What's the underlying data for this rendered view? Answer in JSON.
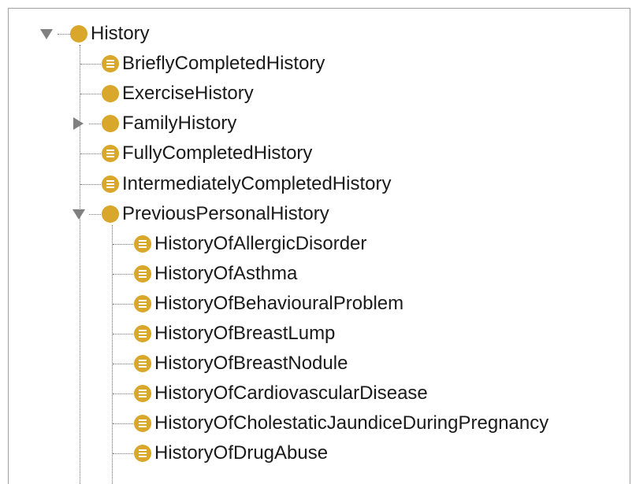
{
  "tree": {
    "root": {
      "label": "History",
      "icon": "class-icon",
      "expanded": true
    },
    "children": [
      {
        "label": "BrieflyCompletedHistory",
        "icon": "defined-class-icon"
      },
      {
        "label": "ExerciseHistory",
        "icon": "class-icon"
      },
      {
        "label": "FamilyHistory",
        "icon": "class-icon",
        "expanded": false
      },
      {
        "label": "FullyCompletedHistory",
        "icon": "defined-class-icon"
      },
      {
        "label": "IntermediatelyCompletedHistory",
        "icon": "defined-class-icon"
      },
      {
        "label": "PreviousPersonalHistory",
        "icon": "class-icon",
        "expanded": true
      }
    ],
    "grandchildren": [
      {
        "label": "HistoryOfAllergicDisorder",
        "icon": "defined-class-icon"
      },
      {
        "label": "HistoryOfAsthma",
        "icon": "defined-class-icon"
      },
      {
        "label": "HistoryOfBehaviouralProblem",
        "icon": "defined-class-icon"
      },
      {
        "label": "HistoryOfBreastLump",
        "icon": "defined-class-icon"
      },
      {
        "label": "HistoryOfBreastNodule",
        "icon": "defined-class-icon"
      },
      {
        "label": "HistoryOfCardiovascularDisease",
        "icon": "defined-class-icon"
      },
      {
        "label": "HistoryOfCholestaticJaundiceDuringPregnancy",
        "icon": "defined-class-icon"
      },
      {
        "label": "HistoryOfDrugAbuse",
        "icon": "defined-class-icon"
      }
    ]
  },
  "colors": {
    "icon_fill": "#d8a72b",
    "toggle": "#808080",
    "connector": "#777777",
    "border": "#a0a0a0"
  }
}
